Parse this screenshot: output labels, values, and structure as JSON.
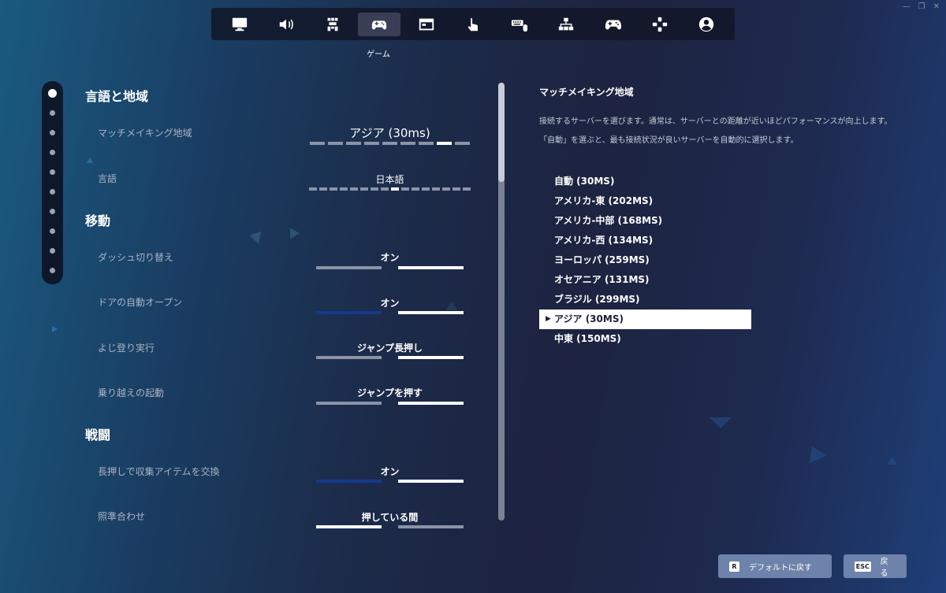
{
  "tabs": [
    {
      "icon": "monitor-icon"
    },
    {
      "icon": "speaker-icon"
    },
    {
      "icon": "accessibility-icon"
    },
    {
      "icon": "gamepad-icon",
      "active": true
    },
    {
      "icon": "window-icon"
    },
    {
      "icon": "touch-icon"
    },
    {
      "icon": "keyboard-mouse-icon"
    },
    {
      "icon": "network-icon"
    },
    {
      "icon": "controller-icon"
    },
    {
      "icon": "dpad-icon"
    },
    {
      "icon": "account-icon"
    }
  ],
  "active_tab_caption": "ゲーム",
  "sections": {
    "language_region": "言語と地域",
    "movement": "移動",
    "combat": "戦闘"
  },
  "settings": {
    "matchmaking": {
      "label": "マッチメイキング地域",
      "value": "アジア (30ms)",
      "segments": 9,
      "selected_index": 7
    },
    "language": {
      "label": "言語",
      "value": "日本語",
      "segments": 16,
      "selected_index": 8
    },
    "dash_toggle": {
      "label": "ダッシュ切り替え",
      "value": "オン"
    },
    "auto_door": {
      "label": "ドアの自動オープン",
      "value": "オン"
    },
    "climb": {
      "label": "よじ登り実行",
      "value": "ジャンプ長押し"
    },
    "mantle": {
      "label": "乗り越えの起動",
      "value": "ジャンプを押す"
    },
    "hold_swap": {
      "label": "長押しで収集アイテムを交換",
      "value": "オン"
    },
    "aim": {
      "label": "照準合わせ",
      "value": "押している間"
    }
  },
  "detail": {
    "title": "マッチメイキング地域",
    "description": "接続するサーバーを選びます。通常は、サーバーとの距離が近いほどパフォーマンスが向上します。「自動」を選ぶと、最も接続状況が良いサーバーを自動的に選択します。"
  },
  "regions": [
    "自動 (30MS)",
    "アメリカ-東 (202MS)",
    "アメリカ-中部 (168MS)",
    "アメリカ-西 (134MS)",
    "ヨーロッパ (259MS)",
    "オセアニア (131MS)",
    "ブラジル (299MS)",
    "アジア (30MS)",
    "中東 (150MS)"
  ],
  "selected_region_index": 7,
  "buttons": {
    "reset": {
      "key": "R",
      "label": "デフォルトに戻す"
    },
    "back": {
      "key": "ESC",
      "label": "戻る"
    }
  },
  "colors": {
    "accent_blue": "#16398c",
    "bar_gray": "#8c93a6",
    "bar_white": "#ffffff",
    "button_bg": "#6d83ab"
  }
}
